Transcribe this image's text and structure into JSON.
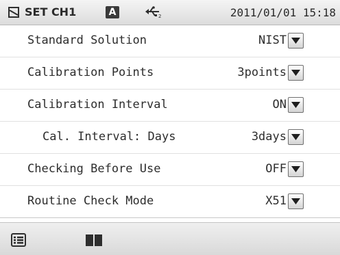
{
  "header": {
    "title": "SET CH1",
    "mode_badge": "A",
    "datetime": "2011/01/01 15:18",
    "icons": [
      "settings-box-icon",
      "usb-icon"
    ]
  },
  "settings": [
    {
      "label": "Standard Solution",
      "value": "NIST"
    },
    {
      "label": "Calibration Points",
      "value": "3points"
    },
    {
      "label": "Calibration Interval",
      "value": "ON"
    },
    {
      "label": "Cal. Interval: Days",
      "value": "3days"
    },
    {
      "label": "Checking Before Use",
      "value": "OFF"
    },
    {
      "label": "Routine Check Mode",
      "value": "X51"
    }
  ],
  "footer": {
    "icons": [
      "list-icon",
      "book-icon"
    ]
  },
  "colors": {
    "header_bg": "#dcdcdc",
    "text": "#2d2d2d",
    "icon_dark": "#3a3a3a"
  }
}
